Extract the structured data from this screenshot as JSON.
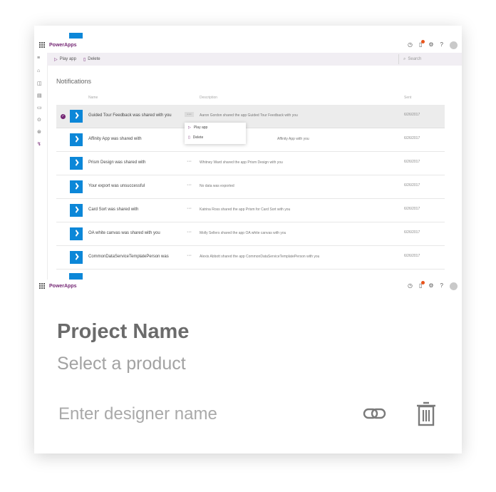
{
  "app": {
    "brand": "PowerApps"
  },
  "topbar_icons": [
    "history-icon",
    "bell-icon",
    "gear-icon",
    "help-icon",
    "avatar"
  ],
  "help_glyph": "?",
  "commandbar": {
    "play_label": "Play app",
    "delete_label": "Delete",
    "search_placeholder": "Search"
  },
  "left_rail": [
    "hamburger-icon",
    "home-icon",
    "learn-icon",
    "apps-icon",
    "create-icon",
    "flows-icon",
    "data-icon",
    "notifications-icon"
  ],
  "page": {
    "title": "Notifications",
    "columns": {
      "name": "Name",
      "description": "Description",
      "sent": "Sent"
    }
  },
  "notifications": [
    {
      "name": "Guided Tour Feedback was shared with you",
      "more": "···",
      "desc": "Aaron Gordon shared the app Guided Tour Feedback with you",
      "sent": "6/26/2017",
      "selected": true
    },
    {
      "name": "Affinity App was shared with",
      "more": "···",
      "desc": "Affinity App with you",
      "sent": "6/26/2017",
      "selected": false
    },
    {
      "name": "Prism Design was shared with",
      "more": "···",
      "desc": "Whitney Ward shared the app Prism Design with you",
      "sent": "6/26/2017",
      "selected": false
    },
    {
      "name": "Your export was unsuccessful",
      "more": "···",
      "desc": "No data was exported",
      "sent": "6/26/2017",
      "selected": false
    },
    {
      "name": "Card Sort was shared with",
      "more": "···",
      "desc": "Katrina Ross shared the app Prism for Card Sort with you",
      "sent": "6/26/2017",
      "selected": false
    },
    {
      "name": "OA white canvas was shared with you",
      "more": "···",
      "desc": "Molly Sellers shared the app OA white canvas with you",
      "sent": "6/26/2017",
      "selected": false
    },
    {
      "name": "CommonDataServiceTemplatePerson was",
      "more": "···",
      "desc": "Alexis Abbott shared the app CommonDataServiceTemplatePerson with you",
      "sent": "6/26/2017",
      "selected": false
    }
  ],
  "context_menu": {
    "items": [
      "Play app",
      "Delete"
    ]
  },
  "project": {
    "title": "Project Name",
    "subtitle": "Select a product",
    "designer_placeholder": "Enter designer name"
  },
  "colors": {
    "brand": "#742774",
    "app_tile": "#0c87d8",
    "notification_badge": "#e8541c"
  }
}
